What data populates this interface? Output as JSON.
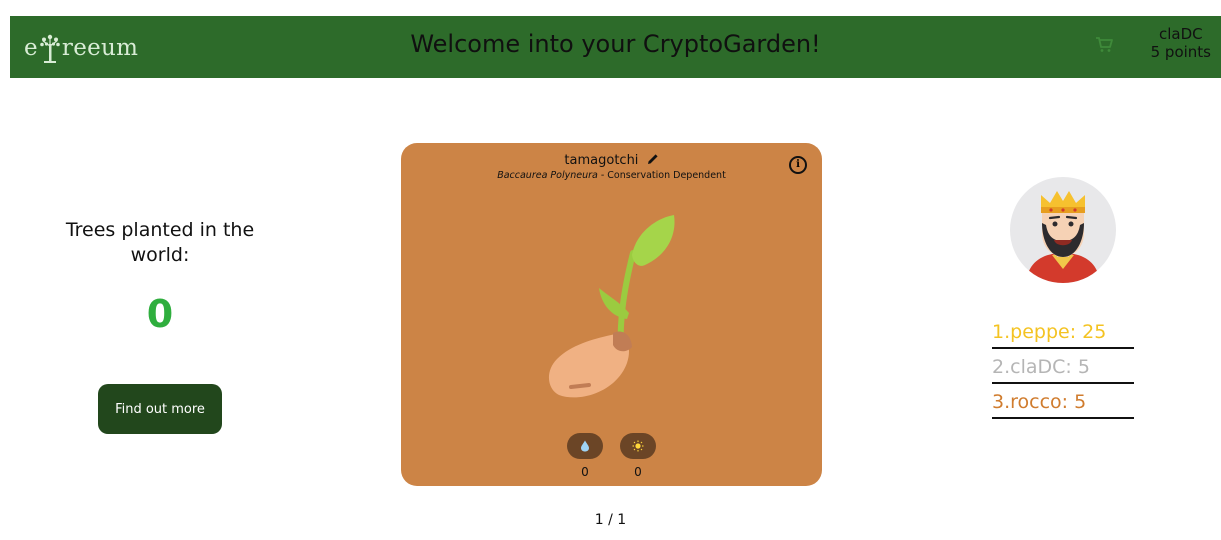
{
  "header": {
    "logo_prefix": "e",
    "logo_suffix": "reeum",
    "title": "Welcome into your CryptoGarden!",
    "username": "claDC",
    "points": "5 points",
    "icons": {
      "logo": "tree-icon",
      "cart": "cart-icon"
    }
  },
  "left": {
    "trees_label": "Trees planted in the world:",
    "trees_count": "0",
    "find_button": "Find out more"
  },
  "plant": {
    "name": "tamagotchi",
    "species": "Baccaurea Polyneura",
    "status": " - Conservation Dependent",
    "info_label": "i",
    "water": "0",
    "sun": "0",
    "icons": {
      "edit": "pencil-icon",
      "info": "info-icon",
      "water": "water-drop-icon",
      "sun": "sun-icon"
    }
  },
  "pager": "1 / 1",
  "leaderboard": [
    {
      "text": "1.peppe: 25",
      "color": "#f4c322"
    },
    {
      "text": "2.claDC: 5",
      "color": "#b5b5b5"
    },
    {
      "text": "3.rocco: 5",
      "color": "#d07c2e"
    }
  ],
  "colors": {
    "header_bg": "#2d6b2a",
    "card_bg": "#cc8446",
    "button_bg": "#22471c",
    "count_color": "#2fae3e"
  }
}
